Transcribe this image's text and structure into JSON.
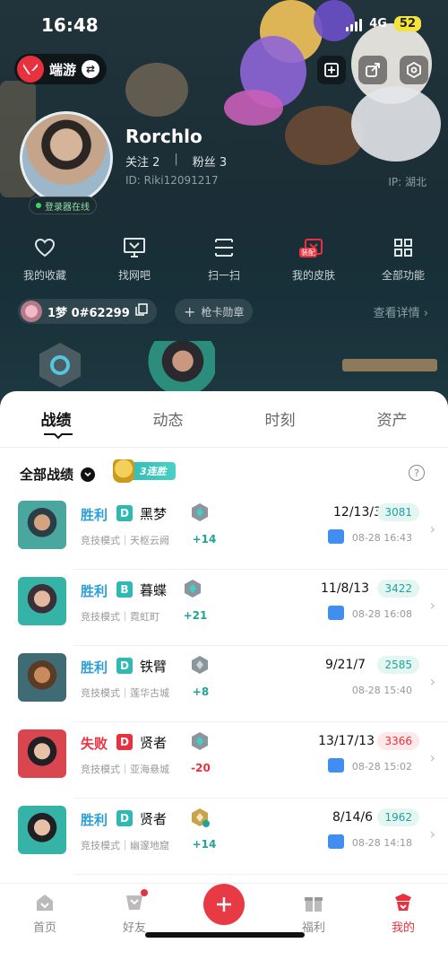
{
  "status": {
    "time": "16:48",
    "network": "4G",
    "battery": "52"
  },
  "app": {
    "name": "端游"
  },
  "profile": {
    "nickname": "Rorchlo",
    "follow_label": "关注 2",
    "fans_label": "粉丝 3",
    "separator": "|",
    "id": "ID: Riki12091217",
    "ip": "IP: 湖北",
    "online_status": "登录器在线"
  },
  "quick_actions": [
    {
      "label": "我的收藏",
      "icon": "heart-icon"
    },
    {
      "label": "找网吧",
      "icon": "monitor-icon"
    },
    {
      "label": "扫一扫",
      "icon": "scan-icon"
    },
    {
      "label": "我的皮肤",
      "icon": "skin-icon",
      "tag": "装配"
    },
    {
      "label": "全部功能",
      "icon": "grid-icon"
    }
  ],
  "game_account": {
    "name": "1梦 0#62299",
    "badge_button": "枪卡勋章",
    "detail_link": "查看详情"
  },
  "tabs": [
    "战绩",
    "动态",
    "时刻",
    "资产"
  ],
  "active_tab": "战绩",
  "filter": {
    "label": "全部战绩",
    "streak": "3连胜"
  },
  "matches": [
    {
      "result": "胜利",
      "win": true,
      "grade": "D",
      "grade_color": "#2fb9b2",
      "agent": "黑梦",
      "mode": "竞技模式｜天枢云阙",
      "delta": "+14",
      "kda": "12/13/3",
      "score": "3081",
      "date": "08-28 16:43",
      "video": true
    },
    {
      "result": "胜利",
      "win": true,
      "grade": "B",
      "grade_color": "#2fb9b2",
      "agent": "暮蝶",
      "mode": "竞技模式｜霓虹町",
      "delta": "+21",
      "kda": "11/8/13",
      "score": "3422",
      "date": "08-28 16:08",
      "video": true
    },
    {
      "result": "胜利",
      "win": true,
      "grade": "D",
      "grade_color": "#2fb9b2",
      "agent": "铁臂",
      "mode": "竞技模式｜莲华古城",
      "delta": "+8",
      "kda": "9/21/7",
      "score": "2585",
      "date": "08-28 15:40",
      "video": false
    },
    {
      "result": "失败",
      "win": false,
      "grade": "D",
      "grade_color": "#e8313f",
      "agent": "贤者",
      "mode": "竞技模式｜亚海悬城",
      "delta": "-20",
      "kda": "13/17/13",
      "score": "3366",
      "date": "08-28 15:02",
      "video": true
    },
    {
      "result": "胜利",
      "win": true,
      "grade": "D",
      "grade_color": "#2fb9b2",
      "agent": "贤者",
      "mode": "竞技模式｜幽邃地窟",
      "delta": "+14",
      "kda": "8/14/6",
      "score": "1962",
      "date": "08-28 14:18",
      "video": true
    }
  ],
  "bottom_nav": [
    {
      "label": "首页",
      "icon": "home-icon"
    },
    {
      "label": "好友",
      "icon": "friends-icon"
    },
    {
      "label": "",
      "icon": "plus-icon"
    },
    {
      "label": "福利",
      "icon": "gift-icon"
    },
    {
      "label": "我的",
      "icon": "profile-icon"
    }
  ],
  "colors": {
    "accent": "#e8313f",
    "teal": "#21a39a",
    "win_blue": "#2a9fd8",
    "hero_bg": "#1b2d35"
  }
}
